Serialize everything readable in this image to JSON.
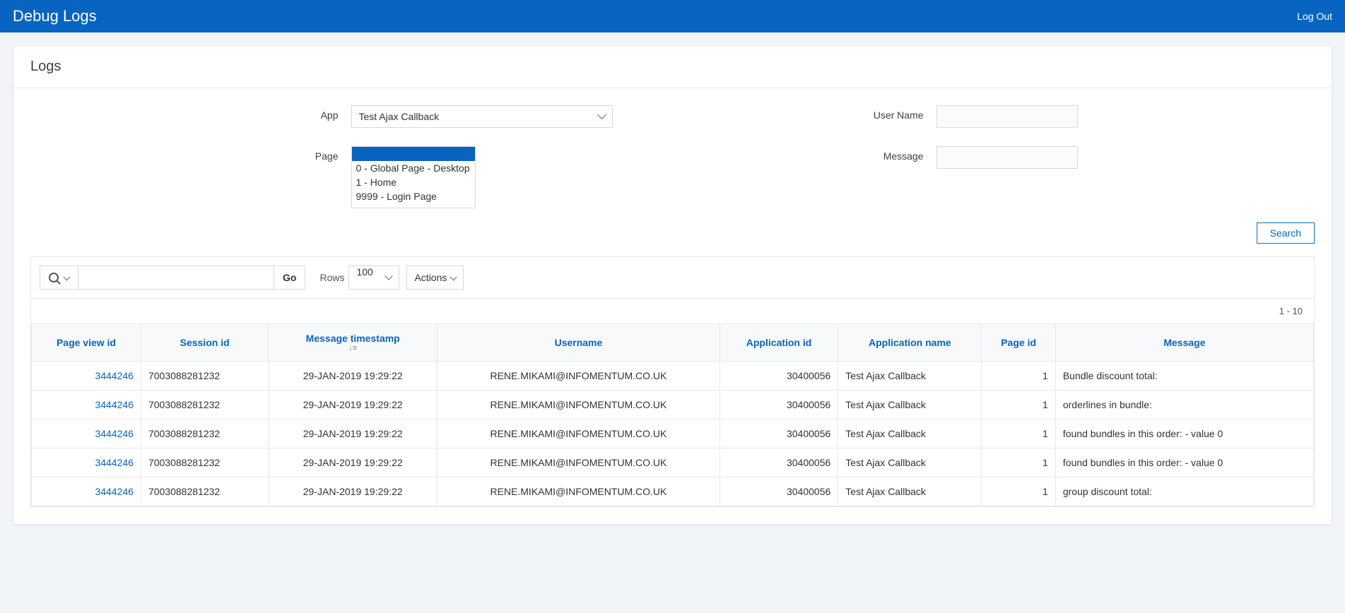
{
  "header": {
    "title": "Debug Logs",
    "logout_label": "Log Out"
  },
  "section_title": "Logs",
  "filters": {
    "app_label": "App",
    "app_selected": "Test Ajax Callback",
    "page_label": "Page",
    "page_options": [
      {
        "label": "",
        "selected": true
      },
      {
        "label": "0 - Global Page - Desktop",
        "selected": false
      },
      {
        "label": "1 - Home",
        "selected": false
      },
      {
        "label": "9999 - Login Page",
        "selected": false
      }
    ],
    "username_label": "User Name",
    "username_value": "",
    "message_label": "Message",
    "message_value": ""
  },
  "search_button": "Search",
  "toolbar": {
    "go_label": "Go",
    "rows_label": "Rows",
    "rows_value": "100",
    "actions_label": "Actions"
  },
  "range_text": "1 - 10",
  "table": {
    "headers": [
      "Page view id",
      "Session id",
      "Message timestamp",
      "Username",
      "Application id",
      "Application name",
      "Page id",
      "Message"
    ],
    "sort_indicator": "↓≡",
    "rows": [
      {
        "pvid": "3444246",
        "sid": "7003088281232",
        "ts": "29-JAN-2019 19:29:22",
        "user": "RENE.MIKAMI@INFOMENTUM.CO.UK",
        "appid": "30400056",
        "appname": "Test Ajax Callback",
        "pid": "1",
        "msg": "Bundle discount total:"
      },
      {
        "pvid": "3444246",
        "sid": "7003088281232",
        "ts": "29-JAN-2019 19:29:22",
        "user": "RENE.MIKAMI@INFOMENTUM.CO.UK",
        "appid": "30400056",
        "appname": "Test Ajax Callback",
        "pid": "1",
        "msg": "orderlines in bundle:"
      },
      {
        "pvid": "3444246",
        "sid": "7003088281232",
        "ts": "29-JAN-2019 19:29:22",
        "user": "RENE.MIKAMI@INFOMENTUM.CO.UK",
        "appid": "30400056",
        "appname": "Test Ajax Callback",
        "pid": "1",
        "msg": "found bundles in this order: - value 0"
      },
      {
        "pvid": "3444246",
        "sid": "7003088281232",
        "ts": "29-JAN-2019 19:29:22",
        "user": "RENE.MIKAMI@INFOMENTUM.CO.UK",
        "appid": "30400056",
        "appname": "Test Ajax Callback",
        "pid": "1",
        "msg": "found bundles in this order: - value 0"
      },
      {
        "pvid": "3444246",
        "sid": "7003088281232",
        "ts": "29-JAN-2019 19:29:22",
        "user": "RENE.MIKAMI@INFOMENTUM.CO.UK",
        "appid": "30400056",
        "appname": "Test Ajax Callback",
        "pid": "1",
        "msg": "group discount total:"
      }
    ]
  }
}
